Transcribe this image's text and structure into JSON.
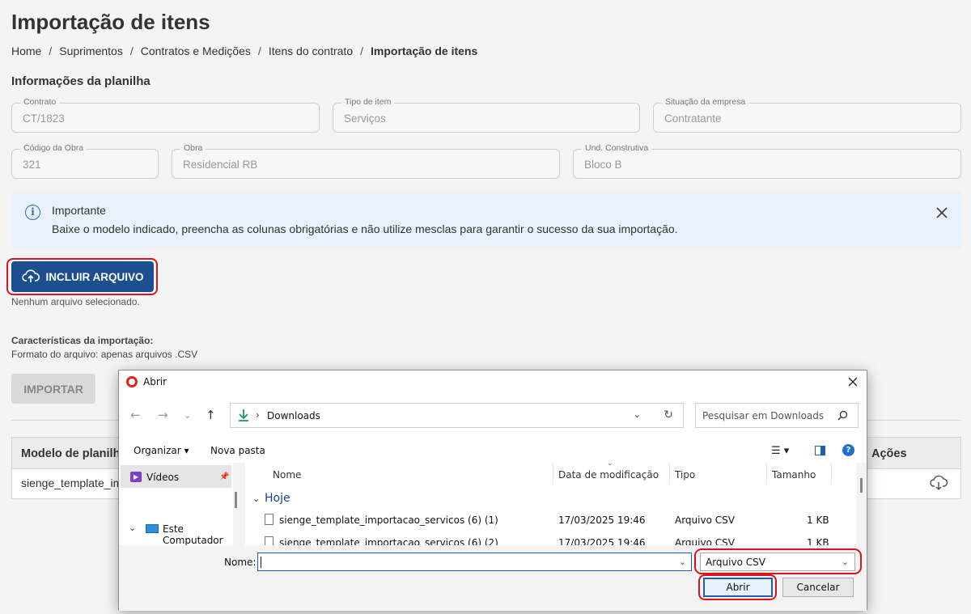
{
  "page": {
    "title": "Importação de itens",
    "breadcrumb": [
      "Home",
      "Suprimentos",
      "Contratos e Medições",
      "Itens do contrato",
      "Importação de itens"
    ],
    "section_title": "Informações da planilha"
  },
  "fields": {
    "contrato": {
      "label": "Contrato",
      "value": "CT/1823"
    },
    "tipo_item": {
      "label": "Tipo de item",
      "value": "Serviços"
    },
    "situacao": {
      "label": "Situação da empresa",
      "value": "Contratante"
    },
    "codigo_obra": {
      "label": "Código da Obra",
      "value": "321"
    },
    "obra": {
      "label": "Obra",
      "value": "Residencial RB"
    },
    "und_construtiva": {
      "label": "Und. Construtiva",
      "value": "Bloco B"
    }
  },
  "alert": {
    "title": "Importante",
    "text": "Baixe o modelo indicado, preencha as colunas obrigatórias e não utilize mesclas para garantir o sucesso da sua importação."
  },
  "upload": {
    "button_label": "INCLUIR ARQUIVO",
    "status": "Nenhum arquivo selecionado."
  },
  "characteristics": {
    "title": "Características da importação:",
    "text": "Formato do arquivo: apenas arquivos .CSV"
  },
  "import_button": "IMPORTAR",
  "table": {
    "col_model": "Modelo de planilha",
    "col_actions": "Ações",
    "row_model": "sienge_template_im"
  },
  "dialog": {
    "title": "Abrir",
    "address": "Downloads",
    "search_placeholder": "Pesquisar em Downloads",
    "organize": "Organizar",
    "new_folder": "Nova pasta",
    "sidebar": [
      "Vídeos",
      "Este Computador"
    ],
    "columns": [
      "Nome",
      "Data de modificação",
      "Tipo",
      "Tamanho"
    ],
    "group": "Hoje",
    "files": [
      {
        "name": "sienge_template_importacao_servicos (6) (1)",
        "date": "17/03/2025 19:46",
        "type": "Arquivo CSV",
        "size": "1 KB"
      },
      {
        "name": "sienge_template_importacao_servicos (6) (2)",
        "date": "17/03/2025 19:46",
        "type": "Arquivo CSV",
        "size": "1 KB"
      }
    ],
    "name_label": "Nome:",
    "name_value": "",
    "file_type": "Arquivo CSV",
    "open_button": "Abrir",
    "cancel_button": "Cancelar"
  },
  "colors": {
    "primary": "#1c4f8f",
    "highlight": "#d8141d",
    "alert_bg": "#e9f1fb"
  }
}
